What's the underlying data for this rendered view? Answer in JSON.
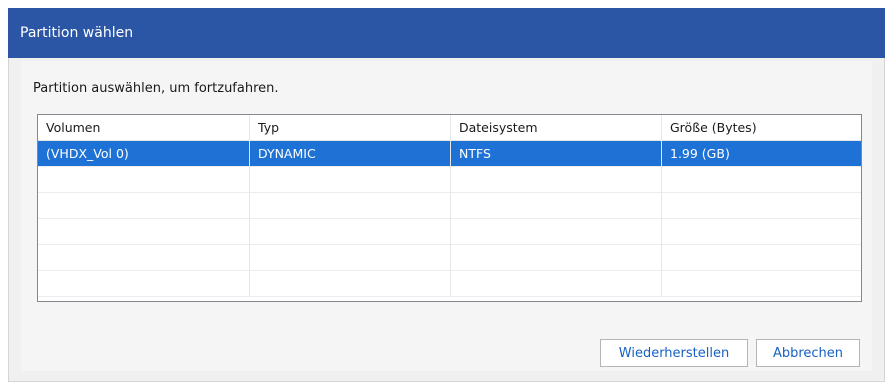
{
  "dialog": {
    "title": "Partition wählen",
    "instruction": "Partition auswählen, um fortzufahren."
  },
  "table": {
    "columns": [
      "Volumen",
      "Typ",
      "Dateisystem",
      "Größe (Bytes)"
    ],
    "rows": [
      [
        "(VHDX_Vol 0)",
        "DYNAMIC",
        "NTFS",
        "1.99 (GB)"
      ],
      [
        "",
        "",
        "",
        ""
      ],
      [
        "",
        "",
        "",
        ""
      ],
      [
        "",
        "",
        "",
        ""
      ],
      [
        "",
        "",
        "",
        ""
      ],
      [
        "",
        "",
        "",
        ""
      ]
    ],
    "selected_row": 0
  },
  "buttons": {
    "restore_label": "Wiederherstellen",
    "cancel_label": "Abbrechen"
  },
  "colors": {
    "titlebar": "#2b56a5",
    "selection": "#1e72d6",
    "button_text": "#1660c4"
  }
}
